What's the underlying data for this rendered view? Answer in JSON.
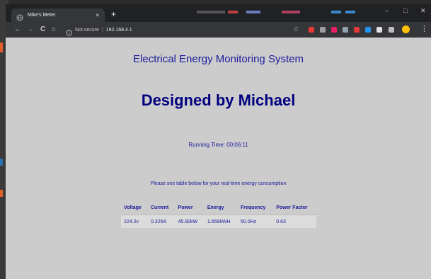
{
  "browser": {
    "tab_title": "Mike's Meter",
    "tab_close": "×",
    "new_tab": "+",
    "window_controls": {
      "minimize": "–",
      "maximize": "□",
      "close": "✕"
    },
    "nav": {
      "back": "←",
      "forward": "→",
      "reload": "C",
      "home": "⌂"
    },
    "security_label": "Not secure",
    "separator": "|",
    "url": "192.168.4.1",
    "bookmark_star": "☆",
    "menu": "⋮",
    "extension_colors": [
      "#e53935",
      "#9e9e9e",
      "#e91e63",
      "#90a4ae",
      "#e53935",
      "#2196f3",
      "#e0e0e0",
      "#bdbdbd",
      "#ffc107"
    ]
  },
  "page": {
    "title": "Electrical Energy Monitoring System",
    "subtitle": "Designed by Michael",
    "running_time": "Running Time: 00:06:11",
    "note": "Please see table below for your real-time energy consumption",
    "table": {
      "headers": [
        "Voltage",
        "Current",
        "Power",
        "Energy",
        "Frequency",
        "Power Factor"
      ],
      "row": [
        "224.2v",
        "0.326A",
        "45.90kW",
        "1.659kWH",
        "50.0Hz",
        "0.63"
      ]
    }
  }
}
